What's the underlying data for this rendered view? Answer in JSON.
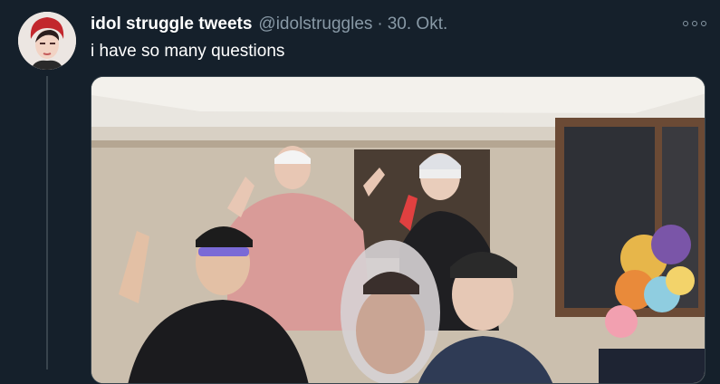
{
  "tweet": {
    "display_name": "idol struggle tweets",
    "handle": "@idolstruggles",
    "separator": "·",
    "date": "30. Okt.",
    "text": "i have so many questions"
  },
  "colors": {
    "background": "#15202b",
    "secondary_text": "#8899a6",
    "border": "#38444d"
  },
  "icons": {
    "more": "more-options-icon"
  }
}
